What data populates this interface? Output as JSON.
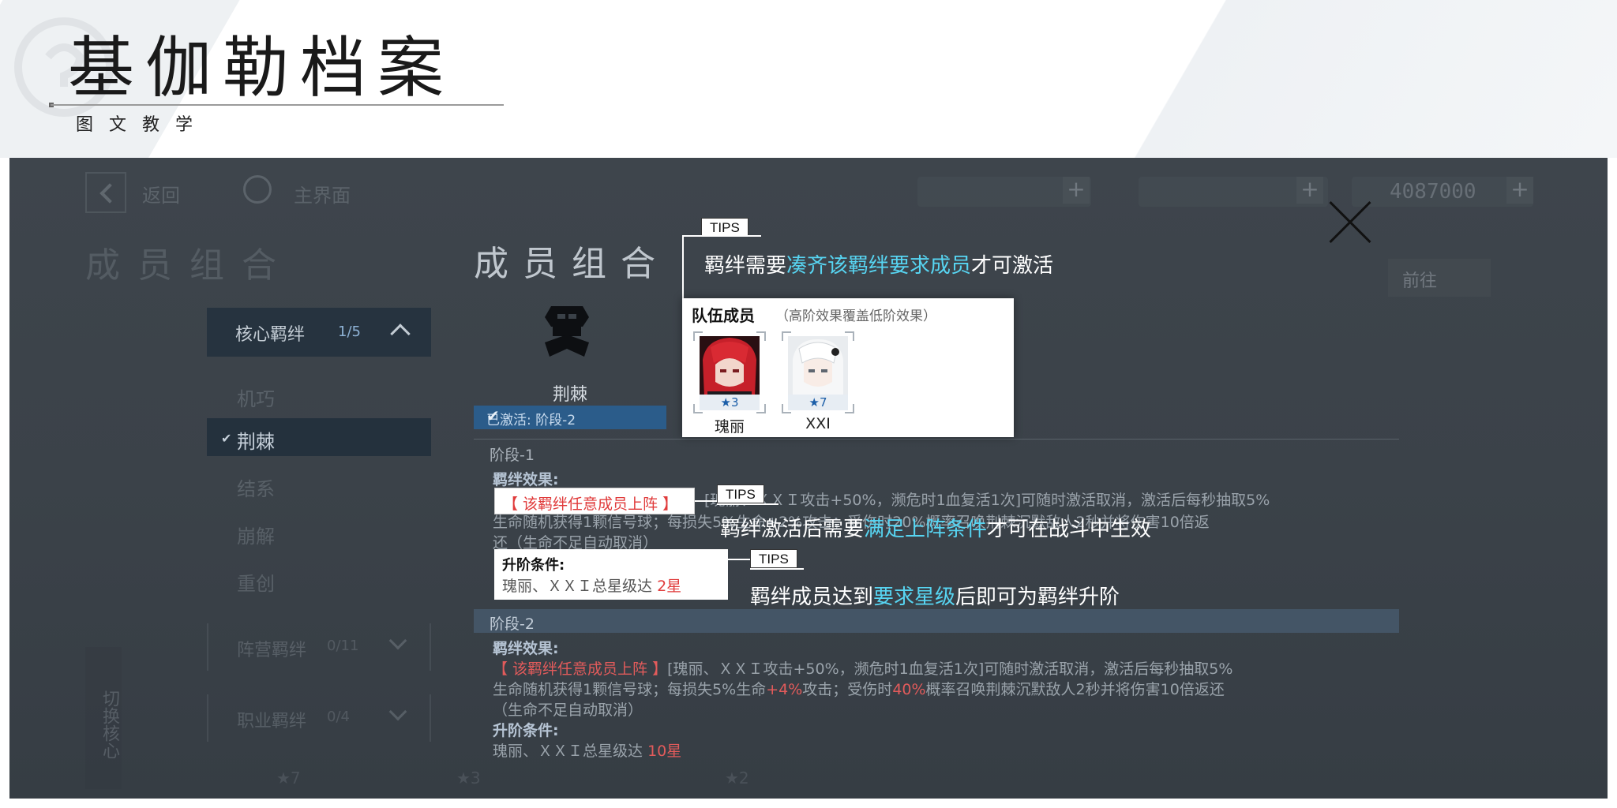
{
  "slide": {
    "title": "基伽勒档案",
    "subtitle": "图文教学"
  },
  "game": {
    "top_bar": {
      "back_label": "返回",
      "home_label": "主界面",
      "resource_value": "4087000",
      "plus_label": "+"
    },
    "page_heading": "成员组合",
    "side_menu": {
      "core_bond": {
        "label": "核心羁绊",
        "count": "1/5"
      },
      "items": [
        {
          "label": "机巧",
          "active": false
        },
        {
          "label": "荆棘",
          "active": true
        },
        {
          "label": "结系",
          "active": false
        },
        {
          "label": "崩解",
          "active": false
        },
        {
          "label": "重创",
          "active": false
        }
      ],
      "camp_bond": {
        "label": "阵营羁绊",
        "count": "0/11"
      },
      "job_bond": {
        "label": "职业羁绊",
        "count": "0/4"
      }
    },
    "switch_core_label": "切换核心",
    "right_button_label": "前往"
  },
  "panel": {
    "title": "成员组合",
    "character_name": "荆棘",
    "active_status": "已激活: 阶段-2",
    "stage1_label": "阶段-1",
    "stage1_effect_label": "羁绊效果:",
    "stage1_effect_line1": "[瑰丽、ＸＸＩ攻击+50%，濒危时1血复活1次]可随时激活取消，激活后每秒抽取5%",
    "stage1_effect_line2": "生命随机获得1颗信号球；每损失5%生命+2%攻击；受伤时20%概率召唤荆棘沉默敌人2秒并将伤害10倍返",
    "stage1_effect_line3": "还（生命不足自动取消）",
    "stage2_label": "阶段-2",
    "stage2_effect_label": "羁绊效果:",
    "stage2_effect_condition": "【 该羁绊任意成员上阵 】",
    "stage2_effect_line1": "[瑰丽、ＸＸＩ攻击+50%，濒危时1血复活1次]可随时激活取消，激活后每秒抽取5%",
    "stage2_effect_line2a": "生命随机获得1颗信号球；每损失5%生命",
    "stage2_effect_line2b": "+4%",
    "stage2_effect_line2c": "攻击；受伤时",
    "stage2_effect_line2d": "40%",
    "stage2_effect_line2e": "概率召唤荆棘沉默敌人2秒并将伤害10倍返还",
    "stage2_effect_line3": "（生命不足自动取消）",
    "stage2_upgrade_label": "升阶条件:",
    "stage2_upgrade_text": "瑰丽、ＸＸＩ总星级达",
    "stage2_upgrade_value": "10星"
  },
  "tips": {
    "tag": "TIPS",
    "tip1": {
      "pre": "羁绊需要",
      "highlight": "凑齐该羁绊要求成员",
      "post": "才可激活"
    },
    "tip2": {
      "pre": "羁绊激活后需要",
      "highlight": "满足上阵条件",
      "post": "才可在战斗中生效"
    },
    "tip3": {
      "pre": "羁绊成员达到",
      "highlight": "要求星级",
      "post": "后即可为羁绊升阶"
    }
  },
  "team_card": {
    "title": "队伍成员",
    "subtitle": "（高阶效果覆盖低阶效果）",
    "members": [
      {
        "name": "瑰丽",
        "stars": "★3"
      },
      {
        "name": "XXI",
        "stars": "★7"
      }
    ]
  },
  "condition_box": {
    "text": "【 该羁绊任意成员上阵 】"
  },
  "upgrade_box": {
    "label": "升阶条件:",
    "text": "瑰丽、ＸＸＩ总星级达",
    "value": "2星"
  },
  "bottom_strip": {
    "items": [
      "★7",
      "★3",
      "★2"
    ]
  },
  "colors": {
    "highlight": "#57d5f2",
    "warning_red": "#e03b3b",
    "active_blue": "#2b5c8a",
    "screen_bg": "#3a4148"
  }
}
